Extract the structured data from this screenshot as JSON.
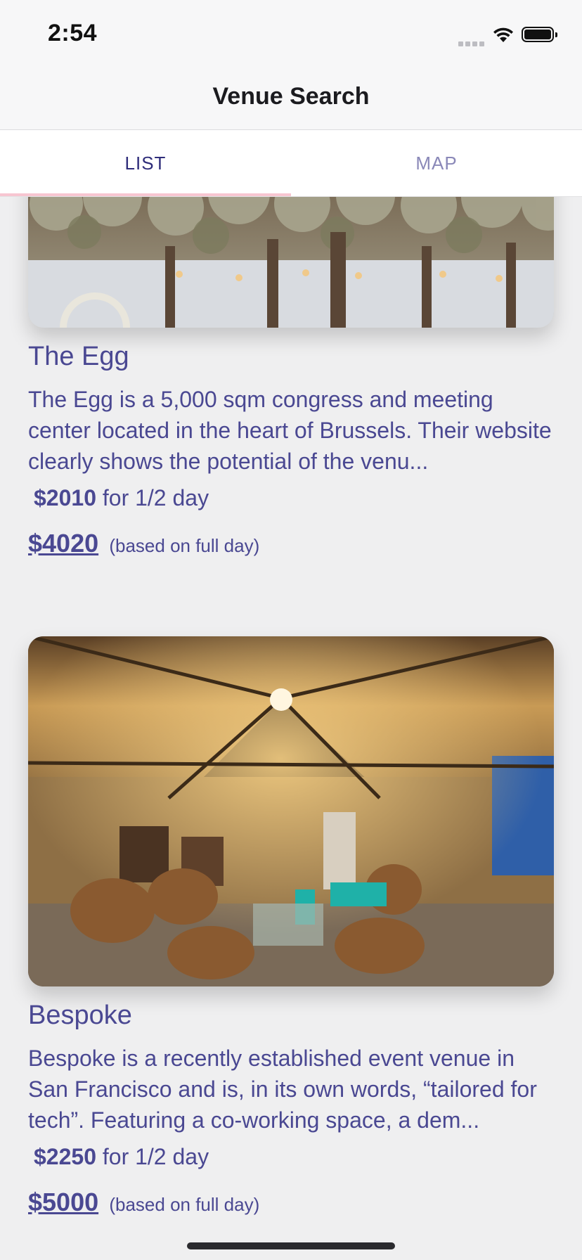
{
  "status": {
    "time": "2:54"
  },
  "nav": {
    "title": "Venue Search"
  },
  "tabs": [
    {
      "label": "LIST",
      "active": true
    },
    {
      "label": "MAP",
      "active": false
    }
  ],
  "venues": [
    {
      "name": "The Egg",
      "description": "The Egg is a 5,000 sqm congress and meeting center located in the heart of Brussels. Their website clearly shows the potential of the venu...",
      "half_day_price": "$2010",
      "half_day_label": "for 1/2 day",
      "full_day_price": "$4020",
      "full_day_label": "(based on full day)"
    },
    {
      "name": "Bespoke",
      "description": "Bespoke is a recently established event venue in San Francisco and is, in its own words, “tailored for tech”. Featuring a co-working space, a dem...",
      "half_day_price": "$2250",
      "half_day_label": "for 1/2 day",
      "full_day_price": "$5000",
      "full_day_label": "(based on full day)"
    }
  ],
  "colors": {
    "accent": "#3f3d86",
    "tab_indicator": "#f7c6d1"
  }
}
